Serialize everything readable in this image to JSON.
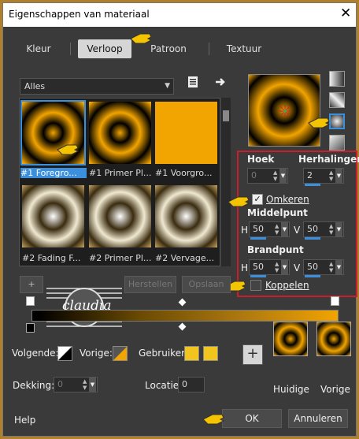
{
  "window": {
    "title": "Eigenschappen van materiaal",
    "close": "✕"
  },
  "tabs": [
    "Kleur",
    "Verloop",
    "Patroon",
    "Textuur"
  ],
  "active_tab": "Verloop",
  "category": {
    "selected": "Alles"
  },
  "gallery": {
    "items": [
      {
        "label": "#1 Foregro...",
        "selected": true
      },
      {
        "label": "#1 Primer Pl..."
      },
      {
        "label": "#1 Voorgro..."
      },
      {
        "label": "#2 Fading F..."
      },
      {
        "label": "#2 Primer Pl..."
      },
      {
        "label": "#2 Vervage..."
      }
    ]
  },
  "settings": {
    "hoek_label": "Hoek",
    "hoek_value": "0",
    "herhalingen_label": "Herhalingen",
    "herhalingen_value": "2",
    "omkeren_label": "Omkeren",
    "omkeren_checked": true,
    "middelpunt_label": "Middelpunt",
    "mp_h_label": "H",
    "mp_h": "50",
    "mp_v_label": "V",
    "mp_v": "50",
    "brandpunt_label": "Brandpunt",
    "bp_h_label": "H",
    "bp_h": "50",
    "bp_v_label": "V",
    "bp_v": "50",
    "koppelen_label": "Koppelen",
    "koppelen_checked": false
  },
  "gallery_buttons": {
    "add": "+",
    "herstellen": "Herstellen",
    "opslaan": "Opslaan"
  },
  "watermark": {
    "text": "claudia"
  },
  "bottom": {
    "volgende_label": "Volgende:",
    "vorige_label": "Vorige:",
    "gebruiker_label": "Gebruiker:",
    "dekking_label": "Dekking:",
    "dekking_value": "0",
    "locatie_label": "Locatie:",
    "locatie_value": "0",
    "add_button": "+",
    "huidige_label": "Huidige",
    "vorige2_label": "Vorige"
  },
  "footer": {
    "help": "Help",
    "ok": "OK",
    "cancel": "Annuleren"
  },
  "colors": {
    "accent": "#3b8fdc",
    "gold": "#f2a400",
    "highlight": "#c8202a",
    "user_swatch": "#f2c51e"
  }
}
